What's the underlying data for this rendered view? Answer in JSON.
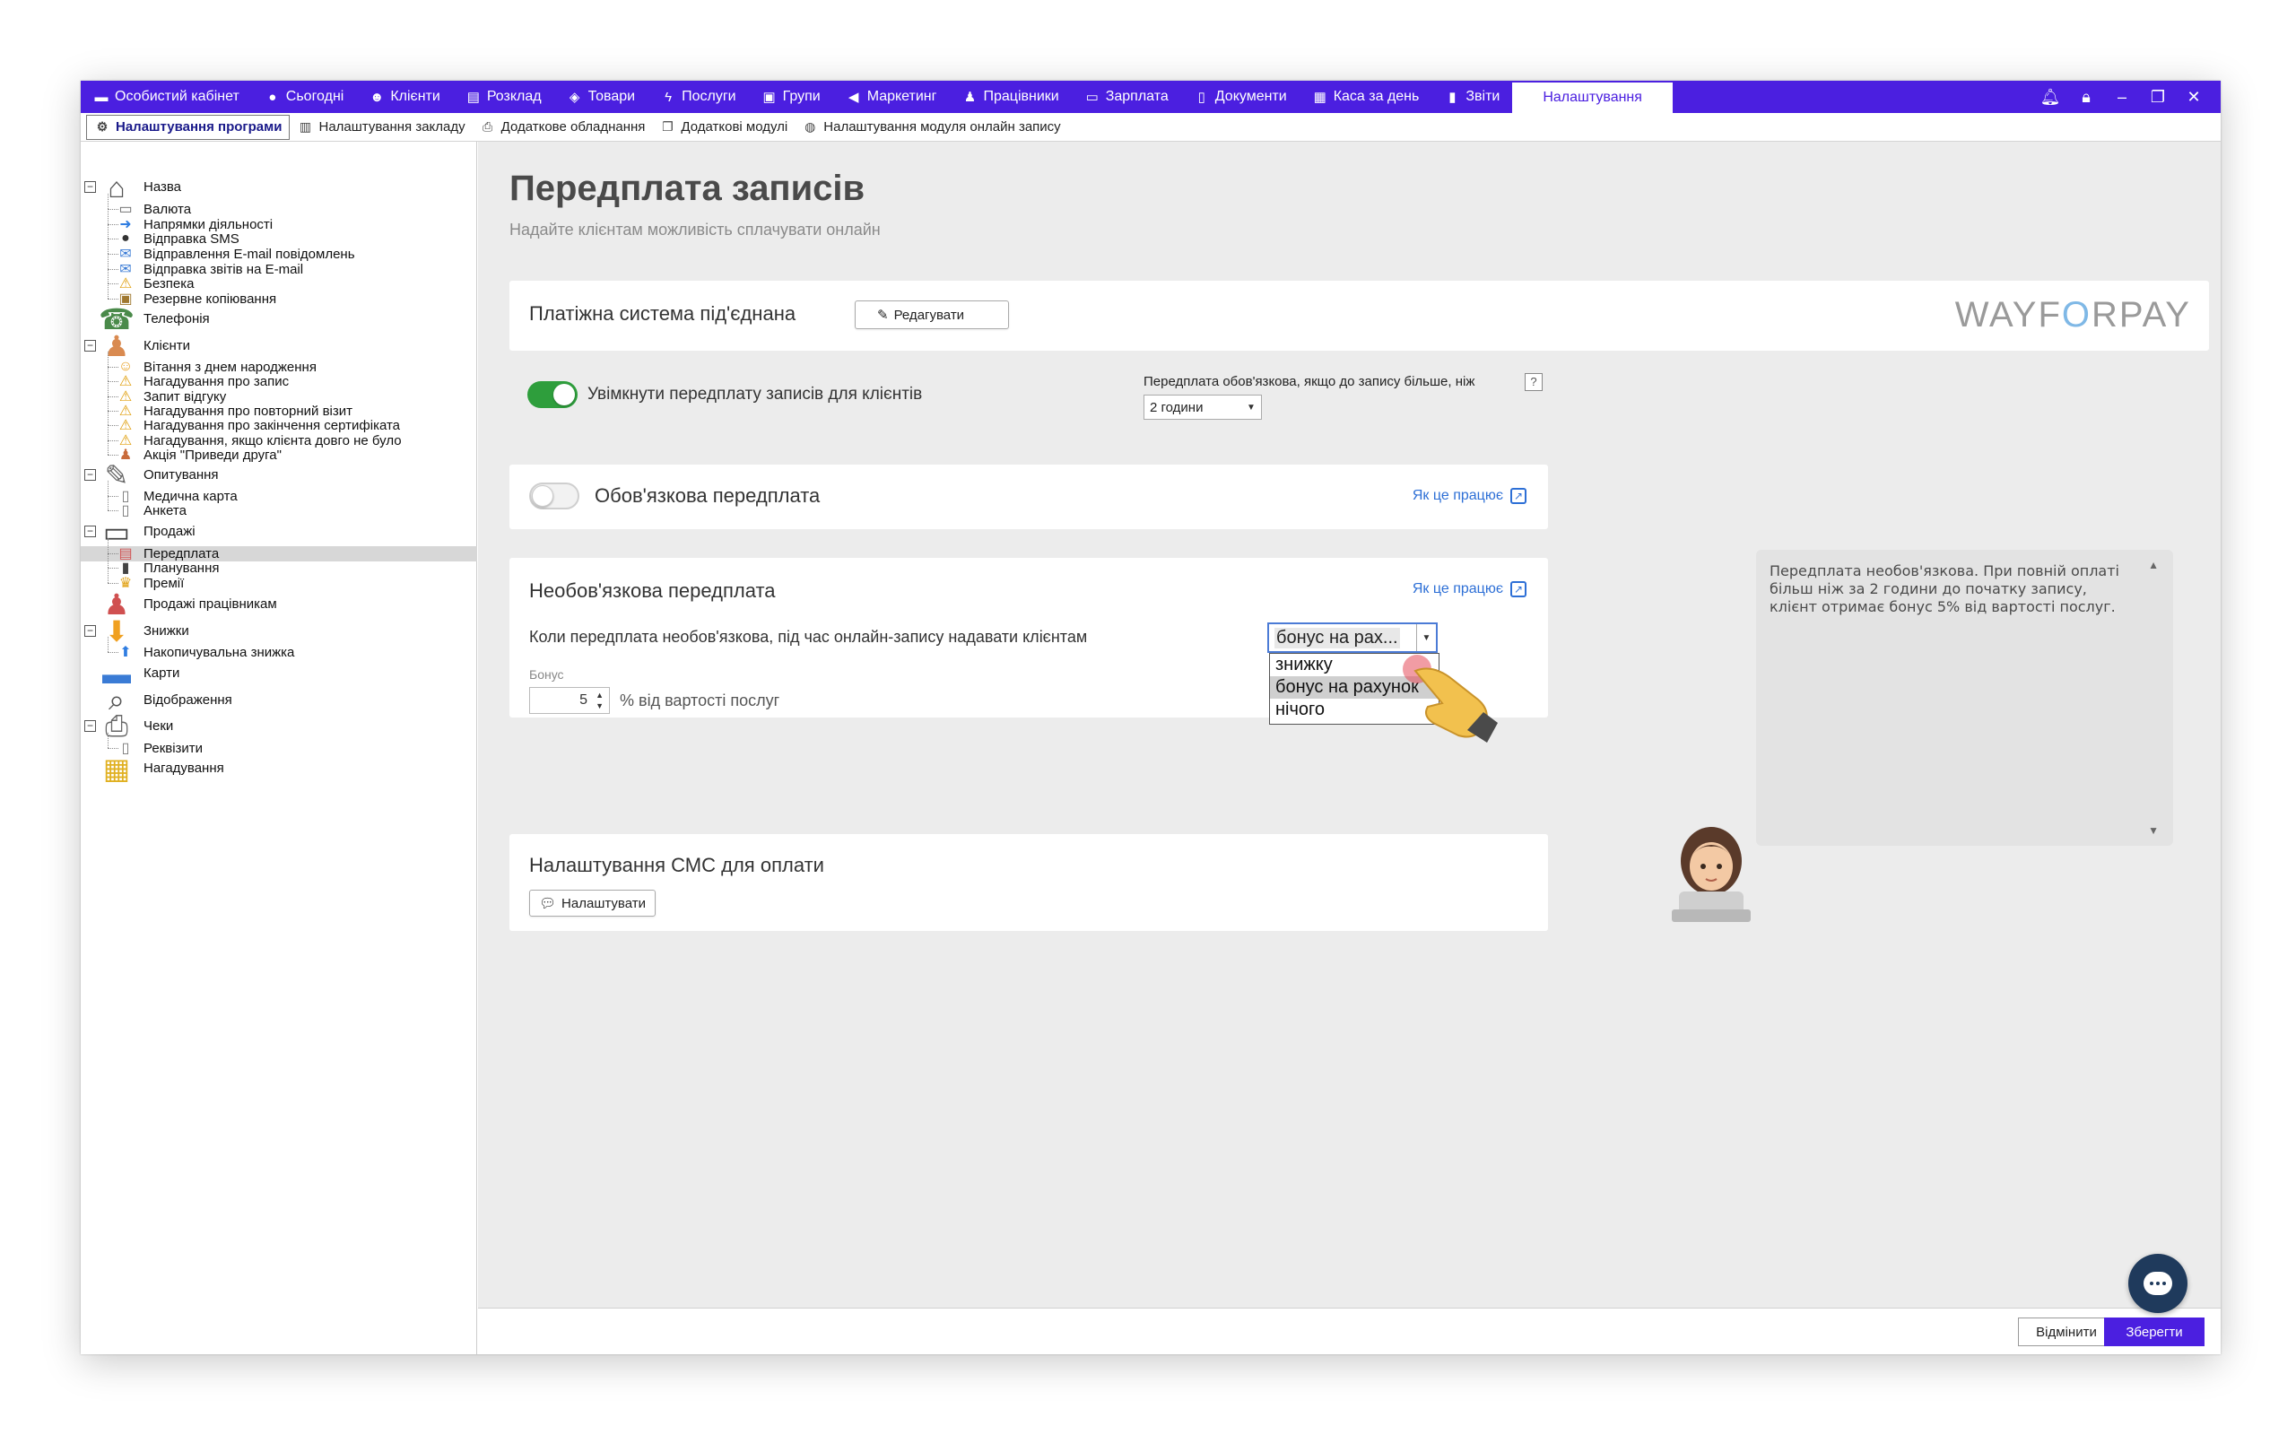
{
  "topnav": {
    "items": [
      {
        "label": "Особистий кабінет",
        "icon": "wallet-icon"
      },
      {
        "label": "Сьогодні",
        "icon": "today-icon"
      },
      {
        "label": "Клієнти",
        "icon": "user-circle-icon"
      },
      {
        "label": "Розклад",
        "icon": "calendar-icon"
      },
      {
        "label": "Товари",
        "icon": "box-icon"
      },
      {
        "label": "Послуги",
        "icon": "lightning-icon"
      },
      {
        "label": "Групи",
        "icon": "group-icon"
      },
      {
        "label": "Маркетинг",
        "icon": "megaphone-icon"
      },
      {
        "label": "Працівники",
        "icon": "person-icon"
      },
      {
        "label": "Зарплата",
        "icon": "cash-icon"
      },
      {
        "label": "Документи",
        "icon": "document-icon"
      },
      {
        "label": "Каса за день",
        "icon": "calculator-icon"
      },
      {
        "label": "Звіти",
        "icon": "bar-chart-icon"
      },
      {
        "label": "Налаштування",
        "icon": ""
      }
    ],
    "active_index": 13
  },
  "subtabs": [
    {
      "label": "Налаштування програми",
      "icon": "gear-icon"
    },
    {
      "label": "Налаштування закладу",
      "icon": "building-icon"
    },
    {
      "label": "Додаткове обладнання",
      "icon": "printer-icon"
    },
    {
      "label": "Додаткові модулі",
      "icon": "modules-icon"
    },
    {
      "label": "Налаштування модуля онлайн запису",
      "icon": "globe-icon"
    }
  ],
  "tree": {
    "nodes": [
      {
        "label": "Назва",
        "icon": "house-icon",
        "level": 0,
        "expander": "−"
      },
      {
        "label": "Валюта",
        "icon": "money-icon",
        "level": 1
      },
      {
        "label": "Напрямки діяльності",
        "icon": "arrow-right-icon",
        "level": 1
      },
      {
        "label": "Відправка SMS",
        "icon": "speech-bubble-icon",
        "level": 1
      },
      {
        "label": "Відправлення E-mail повідомлень",
        "icon": "email-icon",
        "level": 1
      },
      {
        "label": "Відправка звітів на E-mail",
        "icon": "email-report-icon",
        "level": 1
      },
      {
        "label": "Безпека",
        "icon": "warning-icon",
        "level": 1
      },
      {
        "label": "Резервне копіювання",
        "icon": "backup-icon",
        "level": 1
      },
      {
        "label": "Телефонія",
        "icon": "phone-icon",
        "level": 0
      },
      {
        "label": "Клієнти",
        "icon": "client-icon",
        "level": 0,
        "expander": "−"
      },
      {
        "label": "Вітання з днем народження",
        "icon": "smiley-icon",
        "level": 1
      },
      {
        "label": "Нагадування про запис",
        "icon": "bell-icon",
        "level": 1
      },
      {
        "label": "Запит відгуку",
        "icon": "bell-icon",
        "level": 1
      },
      {
        "label": "Нагадування про повторний візит",
        "icon": "bell-icon",
        "level": 1
      },
      {
        "label": "Нагадування про закінчення сертифіката",
        "icon": "bell-icon",
        "level": 1
      },
      {
        "label": "Нагадування, якщо клієнта довго не було",
        "icon": "bell-icon",
        "level": 1
      },
      {
        "label": "Акція \"Приведи друга\"",
        "icon": "people-icon",
        "level": 1
      },
      {
        "label": "Опитування",
        "icon": "survey-icon",
        "level": 0,
        "expander": "−"
      },
      {
        "label": "Медична карта",
        "icon": "form-icon",
        "level": 1
      },
      {
        "label": "Анкета",
        "icon": "form-icon",
        "level": 1
      },
      {
        "label": "Продажі",
        "icon": "sales-icon",
        "level": 0,
        "expander": "−"
      },
      {
        "label": "Передплата",
        "icon": "prepay-icon",
        "level": 1,
        "selected": true
      },
      {
        "label": "Планування",
        "icon": "plan-icon",
        "level": 1
      },
      {
        "label": "Премії",
        "icon": "trophy-icon",
        "level": 1
      },
      {
        "label": "Продажі працівникам",
        "icon": "employee-sales-icon",
        "level": 0
      },
      {
        "label": "Знижки",
        "icon": "discount-arrow-icon",
        "level": 0,
        "expander": "−"
      },
      {
        "label": "Накопичувальна знижка",
        "icon": "arrow-up-icon",
        "level": 1
      },
      {
        "label": "Карти",
        "icon": "card-icon",
        "level": 0
      },
      {
        "label": "Відображення",
        "icon": "magnifier-icon",
        "level": 0
      },
      {
        "label": "Чеки",
        "icon": "receipt-printer-icon",
        "level": 0,
        "expander": "−"
      },
      {
        "label": "Реквізити",
        "icon": "form-icon",
        "level": 1
      },
      {
        "label": "Нагадування",
        "icon": "note-icon",
        "level": 0
      }
    ]
  },
  "page": {
    "title": "Передплата записів",
    "subtitle": "Надайте клієнтам можливість сплачувати онлайн"
  },
  "payment_card": {
    "title": "Платіжна система під'єднана",
    "edit_button": "Редагувати",
    "logo_left": "WAYF",
    "logo_accent": "O",
    "logo_right": "RPAY"
  },
  "enable_row": {
    "toggle_label": "Увімкнути передплату записів для клієнтів",
    "toggle_on": true,
    "required_if_label": "Передплата обов'язкова, якщо до запису більше, ніж",
    "required_if_value": "2 години",
    "help": "?"
  },
  "mandatory_card": {
    "title": "Обов'язкова передплата",
    "toggle_on": false,
    "how_it_works": "Як це працює"
  },
  "optional_card": {
    "title": "Необов'язкова передплата",
    "how_it_works": "Як це працює",
    "prompt": "Коли передплата необов'язкова, під час онлайн-запису надавати клієнтам",
    "select_value": "бонус на рах...",
    "options": [
      "знижку",
      "бонус на рахунок",
      "нічого"
    ],
    "highlighted_option": 1,
    "bonus_label": "Бонус",
    "bonus_value": "5",
    "bonus_suffix": "% від вартості послуг"
  },
  "sms_card": {
    "title": "Налаштування СМС для оплати",
    "button": "Налаштувати"
  },
  "tip": {
    "text": "Передплата необов'язкова. При повній оплаті більш ніж за 2 години до початку запису, клієнт отримає бонус 5% від вартості послуг."
  },
  "footer": {
    "cancel": "Відмінити",
    "save": "Зберегти"
  },
  "colors": {
    "brand": "#4b1fe0",
    "toggle_on": "#2e9e3c",
    "link": "#2d6fd6"
  }
}
